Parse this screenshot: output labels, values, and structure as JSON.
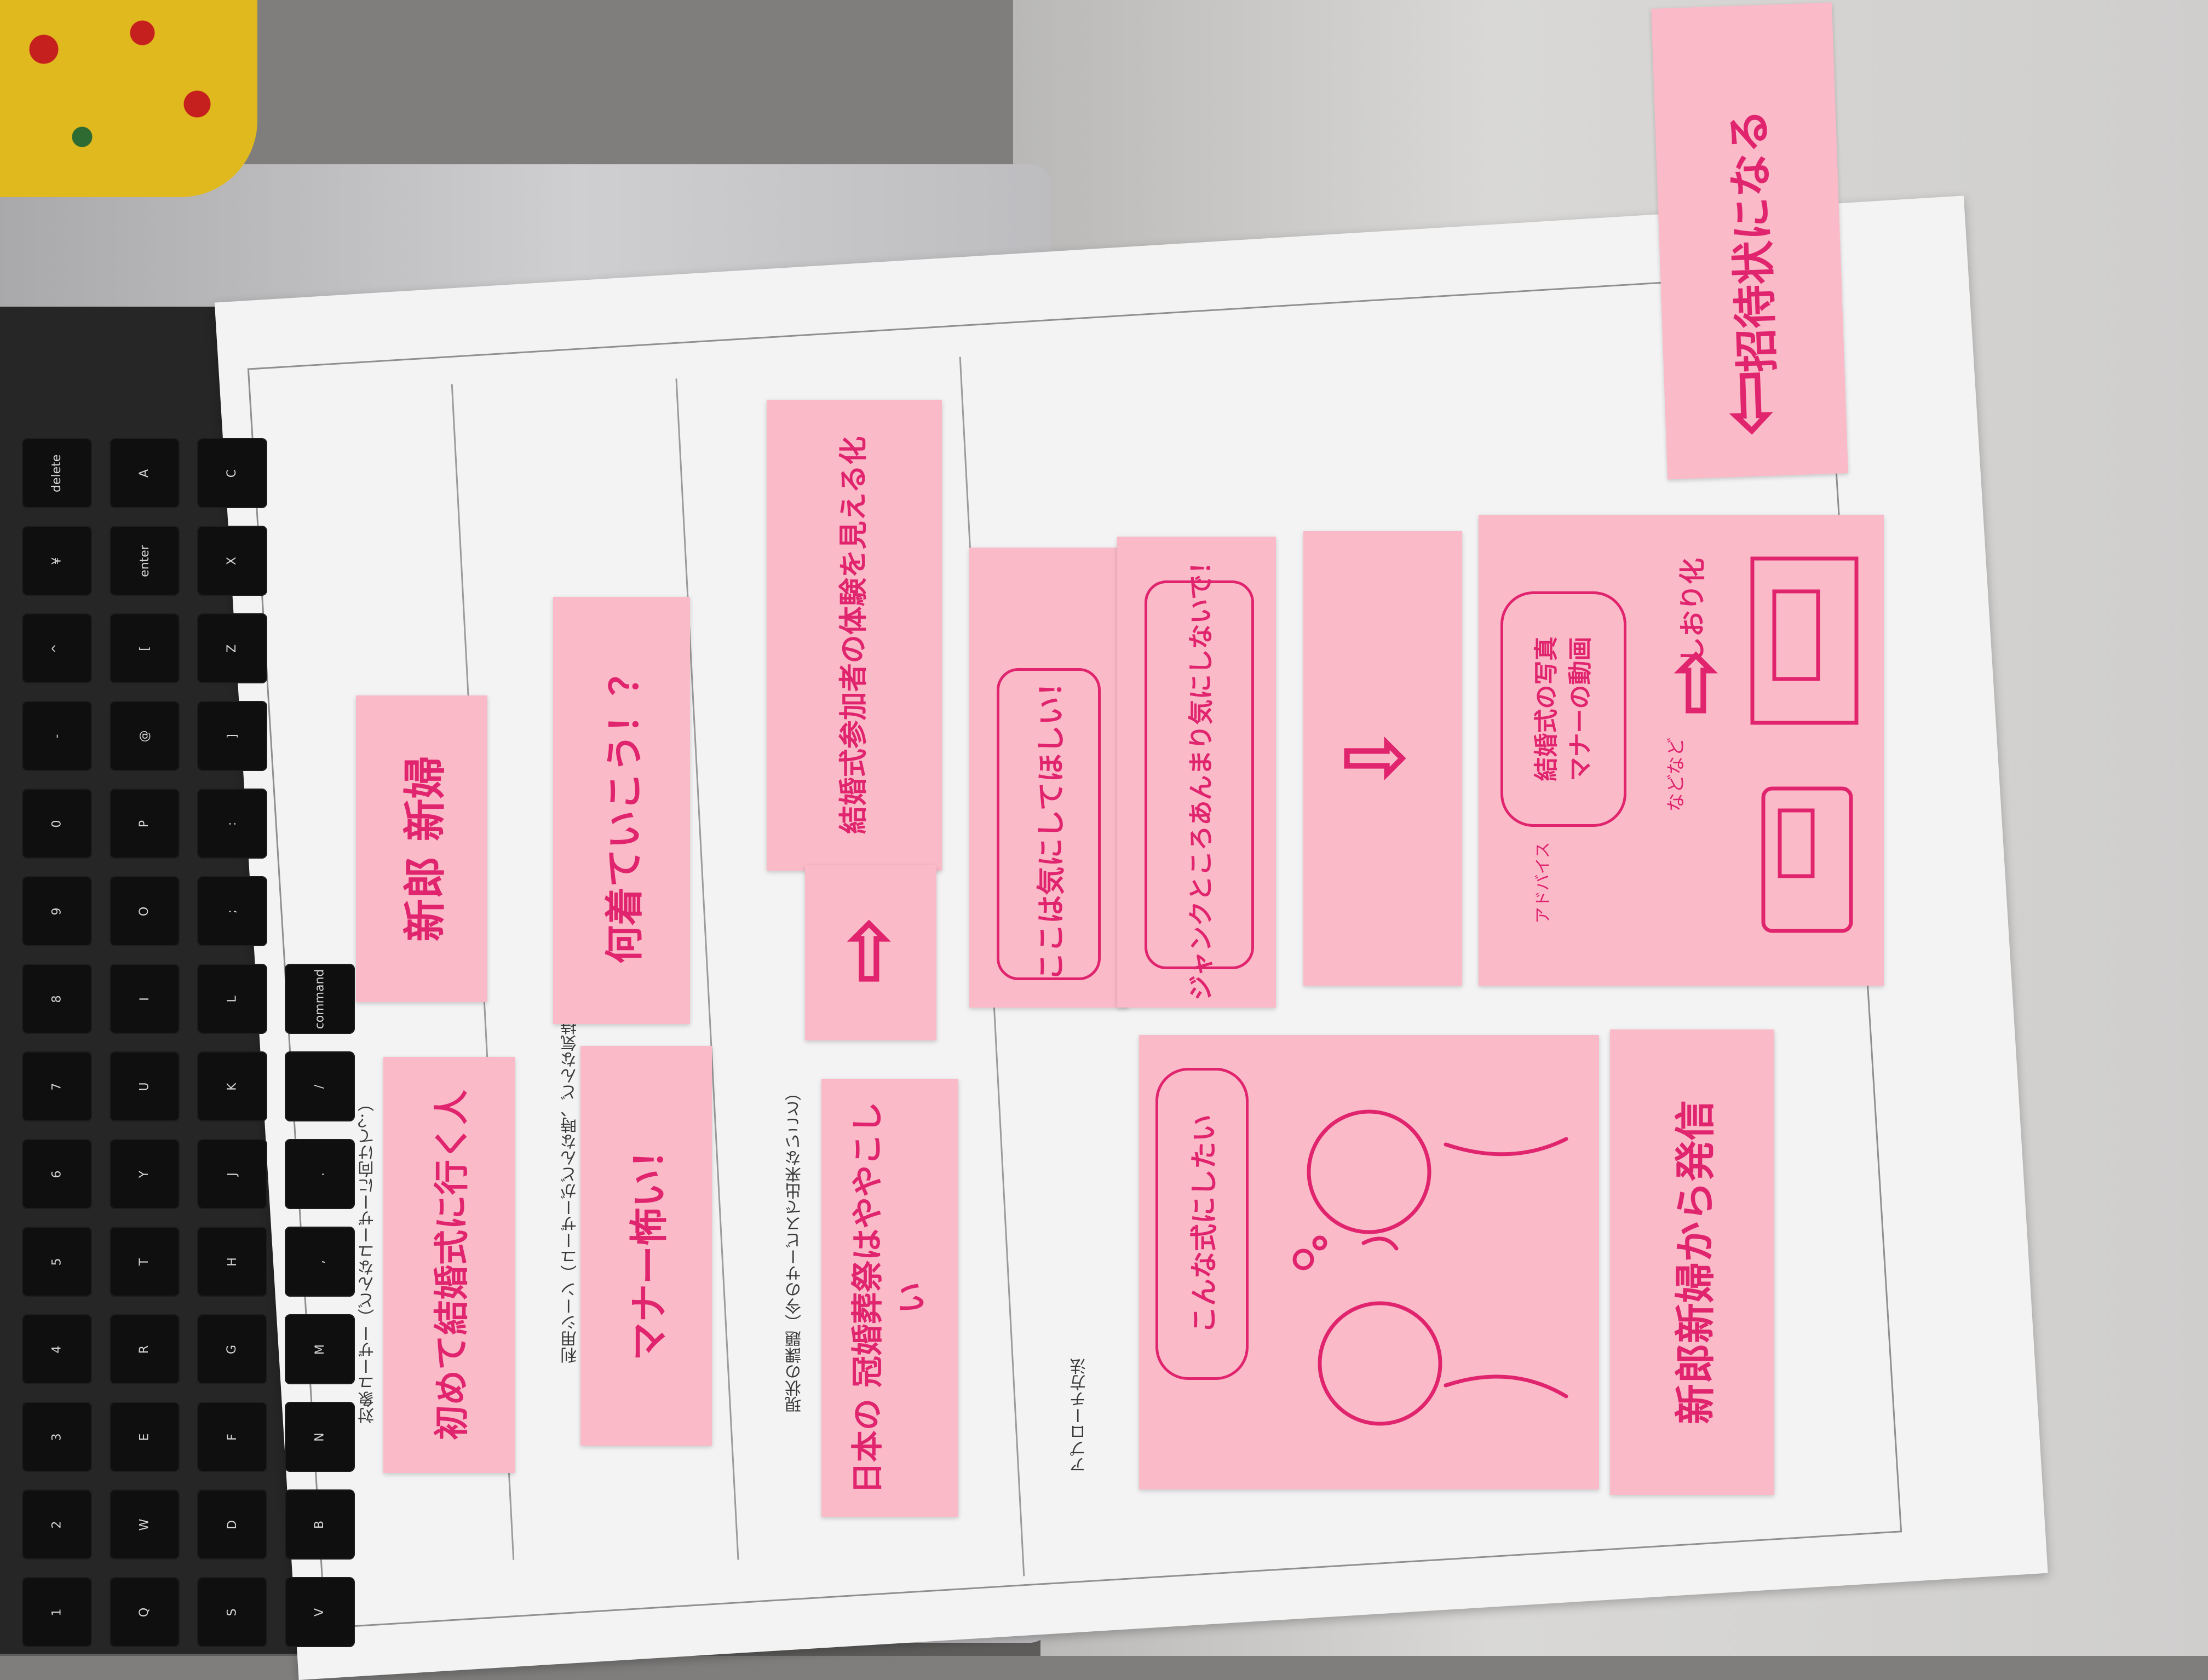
{
  "sections": {
    "target_user": "対象ユーザー（どんなユーザーに向けて？）",
    "usage_scene": "利用シーン（ユーザーがどんな時、どんな気持ちで使うもの？）",
    "current_issue": "現状の課題（今のサービスで出来ないこと）",
    "approach": "アプローチ方法"
  },
  "notes": {
    "groom_bride": "新郎 新婦",
    "first_wedding": "初めて結婚式に行く人",
    "manner_fears": "マナー怖い！",
    "what_to_wear": "何着ていこう！？",
    "japan_formality": "日本の 冠婚葬祭はややこしい",
    "guest_experience": "結婚式参加者の体験を見える化",
    "want_attention": "ここは気にしてほしい！",
    "dont_worry": "ジャンクところあんまり気にしないで！",
    "this_kind_of_ceremony": "こんな式にしたい",
    "from_couple": "新郎新婦から発信",
    "wedding_photo": "結婚式の写真",
    "manner_video": "マナーの動画",
    "etc": "などなど",
    "booklet": "しおり化",
    "advice": "アドバイス",
    "becomes_invitation": "招待状になる"
  },
  "arrow_icon": "arrow-icon",
  "keyboard": {
    "keys": [
      "1",
      "2",
      "3",
      "4",
      "5",
      "6",
      "7",
      "8",
      "9",
      "0",
      "-",
      "^",
      "¥",
      "delete",
      "Q",
      "W",
      "E",
      "R",
      "T",
      "Y",
      "U",
      "I",
      "O",
      "P",
      "@",
      "[",
      "enter",
      "A",
      "S",
      "D",
      "F",
      "G",
      "H",
      "J",
      "K",
      "L",
      ";",
      ":",
      "]",
      "Z",
      "X",
      "C",
      "V",
      "B",
      "N",
      "M",
      ",",
      ".",
      "/",
      "command"
    ]
  }
}
